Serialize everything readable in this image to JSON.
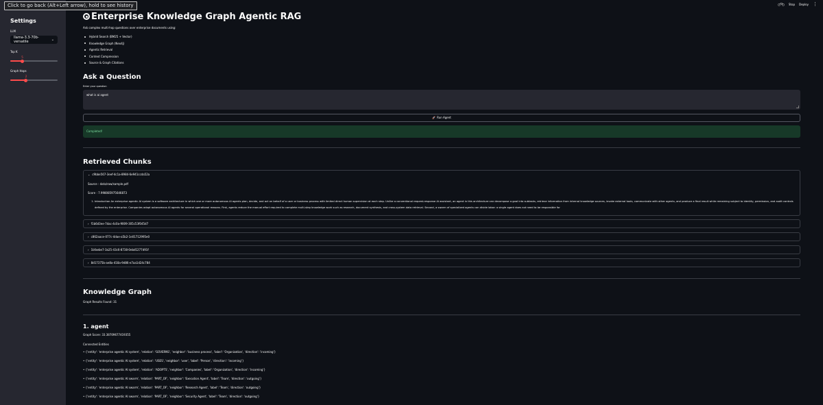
{
  "browser": {
    "back_tooltip": "Click to go back (Alt+Left arrow), hold to see history"
  },
  "topbar": {
    "stop_label": "Stop",
    "deploy_label": "Deploy",
    "running_icon": "bike-icon",
    "menu_icon": "kebab-menu-icon"
  },
  "sidebar": {
    "title": "Settings",
    "llm_label": "LLM",
    "llm_value": "llama-3.3-70b-versatile",
    "topk_label": "Top K",
    "topk_value": "5",
    "topk_fraction": 0.25,
    "hops_label": "Graph Hops",
    "hops_value": "2",
    "hops_fraction": 0.33
  },
  "header": {
    "title": "Enterprise Knowledge Graph Agentic RAG",
    "icon": "globe-icon",
    "description": "Ask complex multi-hop questions over enterprise documents using:",
    "features": [
      "Hybrid Search (BM25 + Vector)",
      "Knowledge Graph (Neo4j)",
      "Agentic Retrieval",
      "Context Compression",
      "Source & Graph Citations"
    ]
  },
  "ask": {
    "heading": "Ask a Question",
    "input_label": "Enter your question",
    "input_value": "what is ai agent",
    "run_label": "Run Agent",
    "run_icon": "rocket-icon",
    "status": "Completed!"
  },
  "chunks": {
    "heading": "Retrieved Chunks",
    "open": {
      "id": "c9bbe567-3eef-4c1a-8984-6e941ccda52a",
      "source": "Source : data/raw/sample.pdf",
      "score": "Score : 7.998085975646873",
      "text": "Introduction An enterprise agentic AI system is a software architecture in which one or more autonomous AI agents plan, decide, and act on behalf of a user or business process with limited direct human supervision at each step. Unlike a conventional request-response AI assistant, an agent in this architecture can decompose a goal into subtasks, retrieve information from internal knowledge sources, invoke external tools, communicate with other agents, and produce a final result while remaining subject to identity, permission, and audit controls defined by the enterprise. Companies adopt autonomous AI agents for several operational reasons. First, agents reduce the manual effort required to complete multi-step knowledge work such as research, document synthesis, and cross-system data retrieval. Second, a swarm of specialized agents can divide labor: a single agent does not need to be responsible for"
    },
    "collapsed": [
      "f1b6d3ee-7dac-4c0a-9009-305c53f045d7",
      "c862aace-077c-4dae-a5b2-1e01712995e0",
      "1bfaebe7-3a25-43c6-8738-0ebd1277d91f",
      "8d17375b-ae8a-418a-9d86-e7aa1d24c784"
    ]
  },
  "kg": {
    "heading": "Knowledge Graph",
    "results": "Graph Results Found: 31",
    "item_title": "1. agent",
    "graph_score": "Graph Score: 33.38709677419355",
    "connected_label": "Connected Entities",
    "entities": [
      "• {'entity': 'enterprise agentic AI system', 'relation': 'GOVERNS', 'neighbor': 'business process', 'label': 'Organization', 'direction': 'incoming'}",
      "• {'entity': 'enterprise agentic AI system', 'relation': 'USES', 'neighbor': 'user', 'label': 'Person', 'direction': 'incoming'}",
      "• {'entity': 'enterprise agentic AI system', 'relation': 'ADOPTS', 'neighbor': 'Companies', 'label': 'Organization', 'direction': 'incoming'}",
      "• {'entity': 'enterprise agentic AI swarm', 'relation': 'PART_OF', 'neighbor': 'Execution Agent', 'label': 'Team', 'direction': 'outgoing'}",
      "• {'entity': 'enterprise agentic AI swarm', 'relation': 'PART_OF', 'neighbor': 'Research Agent', 'label': 'Team', 'direction': 'outgoing'}",
      "• {'entity': 'enterprise agentic AI swarm', 'relation': 'PART_OF', 'neighbor': 'Security Agent', 'label': 'Team', 'direction': 'outgoing'}"
    ]
  }
}
